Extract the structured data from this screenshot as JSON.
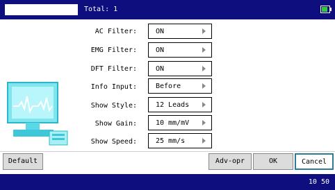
{
  "header": {
    "total_label": "Total: 1",
    "battery_color": "#2ecc3a"
  },
  "settings": [
    {
      "label": "AC Filter:",
      "value": "ON"
    },
    {
      "label": "EMG Filter:",
      "value": "ON"
    },
    {
      "label": "DFT Filter:",
      "value": "ON"
    },
    {
      "label": "Info Input:",
      "value": "Before"
    },
    {
      "label": "Show Style:",
      "value": "12 Leads"
    },
    {
      "label": "Show Gain:",
      "value": "10 mm/mV"
    },
    {
      "label": "Show Speed:",
      "value": "25 mm/s"
    }
  ],
  "buttons": {
    "default": "Default",
    "adv": "Adv-opr",
    "ok": "OK",
    "cancel": "Cancel"
  },
  "status": {
    "time": "10 50"
  },
  "colors": {
    "bar": "#0e0e7e",
    "accent": "#2b7d95"
  }
}
